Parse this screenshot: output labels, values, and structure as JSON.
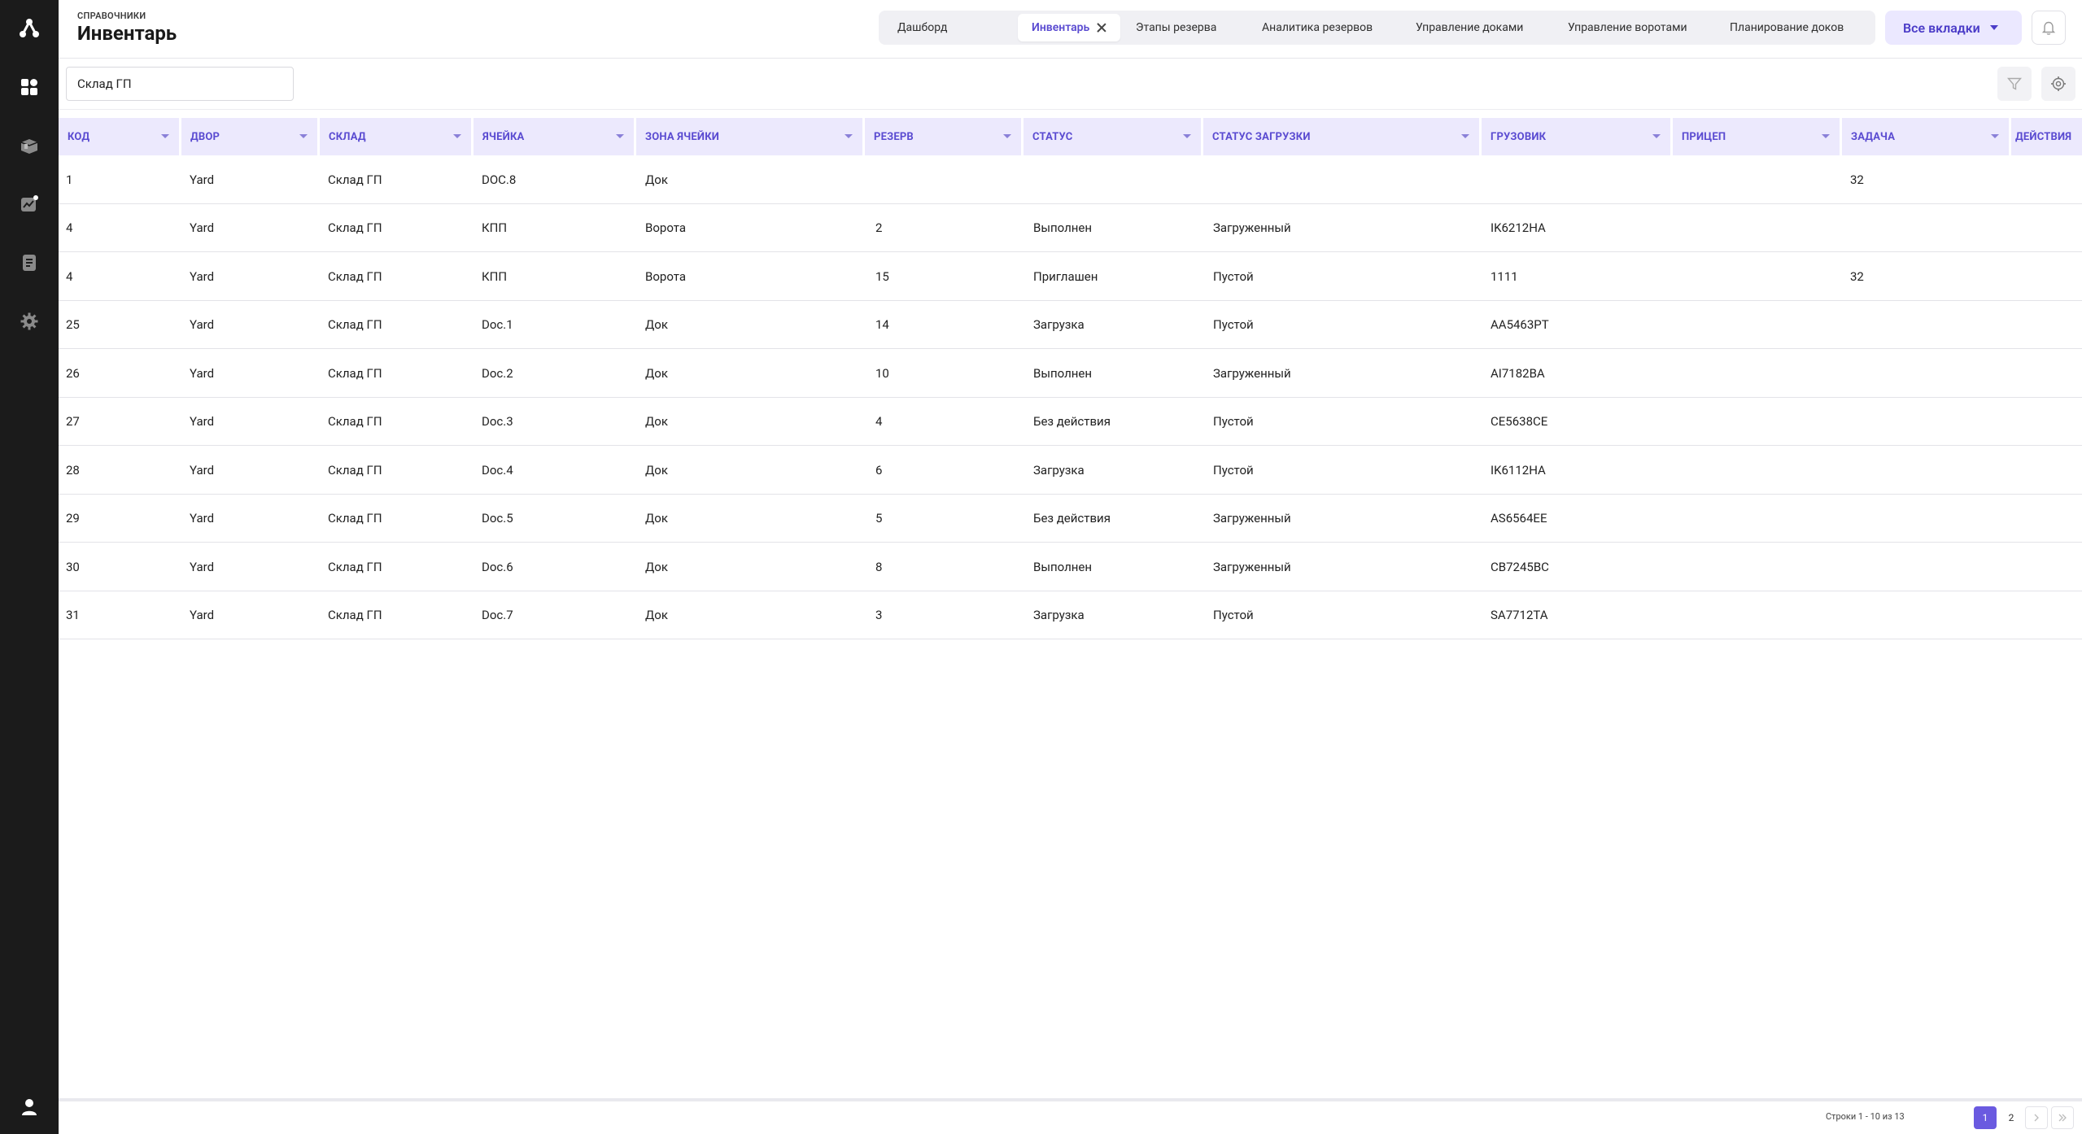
{
  "header": {
    "breadcrumb": "СПРАВОЧНИКИ",
    "title": "Инвентарь"
  },
  "tabs": [
    {
      "label": "Дашборд"
    },
    {
      "label": "Инвентарь",
      "active": true
    },
    {
      "label": "Этапы резерва"
    },
    {
      "label": "Аналитика резервов"
    },
    {
      "label": "Управление доками"
    },
    {
      "label": "Управление воротами"
    },
    {
      "label": "Планирование доков"
    }
  ],
  "all_tabs_label": "Все вкладки",
  "search": {
    "value": "Склад ГП"
  },
  "table": {
    "columns": [
      "КОД",
      "ДВОР",
      "СКЛАД",
      "ЯЧЕЙКА",
      "ЗОНА ЯЧЕЙКИ",
      "РЕЗЕРВ",
      "СТАТУС",
      "СТАТУС ЗАГРУЗКИ",
      "ГРУЗОВИК",
      "ПРИЦЕП",
      "ЗАДАЧА",
      "ДЕЙСТВИЯ"
    ],
    "rows": [
      [
        "1",
        "Yard",
        "Склад ГП",
        "DOC.8",
        "Док",
        "",
        "",
        "",
        "",
        "",
        "32",
        ""
      ],
      [
        "4",
        "Yard",
        "Склад ГП",
        "КПП",
        "Ворота",
        "2",
        "Выполнен",
        "Загруженный",
        "IK6212HA",
        "",
        "",
        ""
      ],
      [
        "4",
        "Yard",
        "Склад ГП",
        "КПП",
        "Ворота",
        "15",
        "Приглашен",
        "Пустой",
        "1111",
        "",
        "32",
        ""
      ],
      [
        "25",
        "Yard",
        "Склад ГП",
        "Doc.1",
        "Док",
        "14",
        "Загрузка",
        "Пустой",
        "AA5463PT",
        "",
        "",
        ""
      ],
      [
        "26",
        "Yard",
        "Склад ГП",
        "Doc.2",
        "Док",
        "10",
        "Выполнен",
        "Загруженный",
        "AI7182BA",
        "",
        "",
        ""
      ],
      [
        "27",
        "Yard",
        "Склад ГП",
        "Doc.3",
        "Док",
        "4",
        "Без действия",
        "Пустой",
        "CE5638CE",
        "",
        "",
        ""
      ],
      [
        "28",
        "Yard",
        "Склад ГП",
        "Doc.4",
        "Док",
        "6",
        "Загрузка",
        "Пустой",
        "IK6112HA",
        "",
        "",
        ""
      ],
      [
        "29",
        "Yard",
        "Склад ГП",
        "Doc.5",
        "Док",
        "5",
        "Без действия",
        "Загруженный",
        "AS6564EE",
        "",
        "",
        ""
      ],
      [
        "30",
        "Yard",
        "Склад ГП",
        "Doc.6",
        "Док",
        "8",
        "Выполнен",
        "Загруженный",
        "CB7245BC",
        "",
        "",
        ""
      ],
      [
        "31",
        "Yard",
        "Склад ГП",
        "Doc.7",
        "Док",
        "3",
        "Загрузка",
        "Пустой",
        "SA7712TA",
        "",
        "",
        ""
      ]
    ]
  },
  "pagination": {
    "info": "Строки 1 - 10 из 13",
    "pages": [
      "1",
      "2"
    ],
    "current": "1"
  },
  "icons": {
    "sidebar": [
      "logo-icon",
      "dashboard-icon",
      "inventory-box-icon",
      "analytics-chart-icon",
      "documents-icon",
      "settings-gear-icon",
      "user-profile-icon"
    ],
    "toolbar": [
      "filter-icon",
      "settings-icon"
    ],
    "header": [
      "bell-icon"
    ]
  },
  "colors": {
    "accent": "#5a4bd1",
    "sidebar_bg": "#1b1b1b",
    "header_row_bg": "#ece9fd",
    "active_page": "#6a5ae0"
  }
}
